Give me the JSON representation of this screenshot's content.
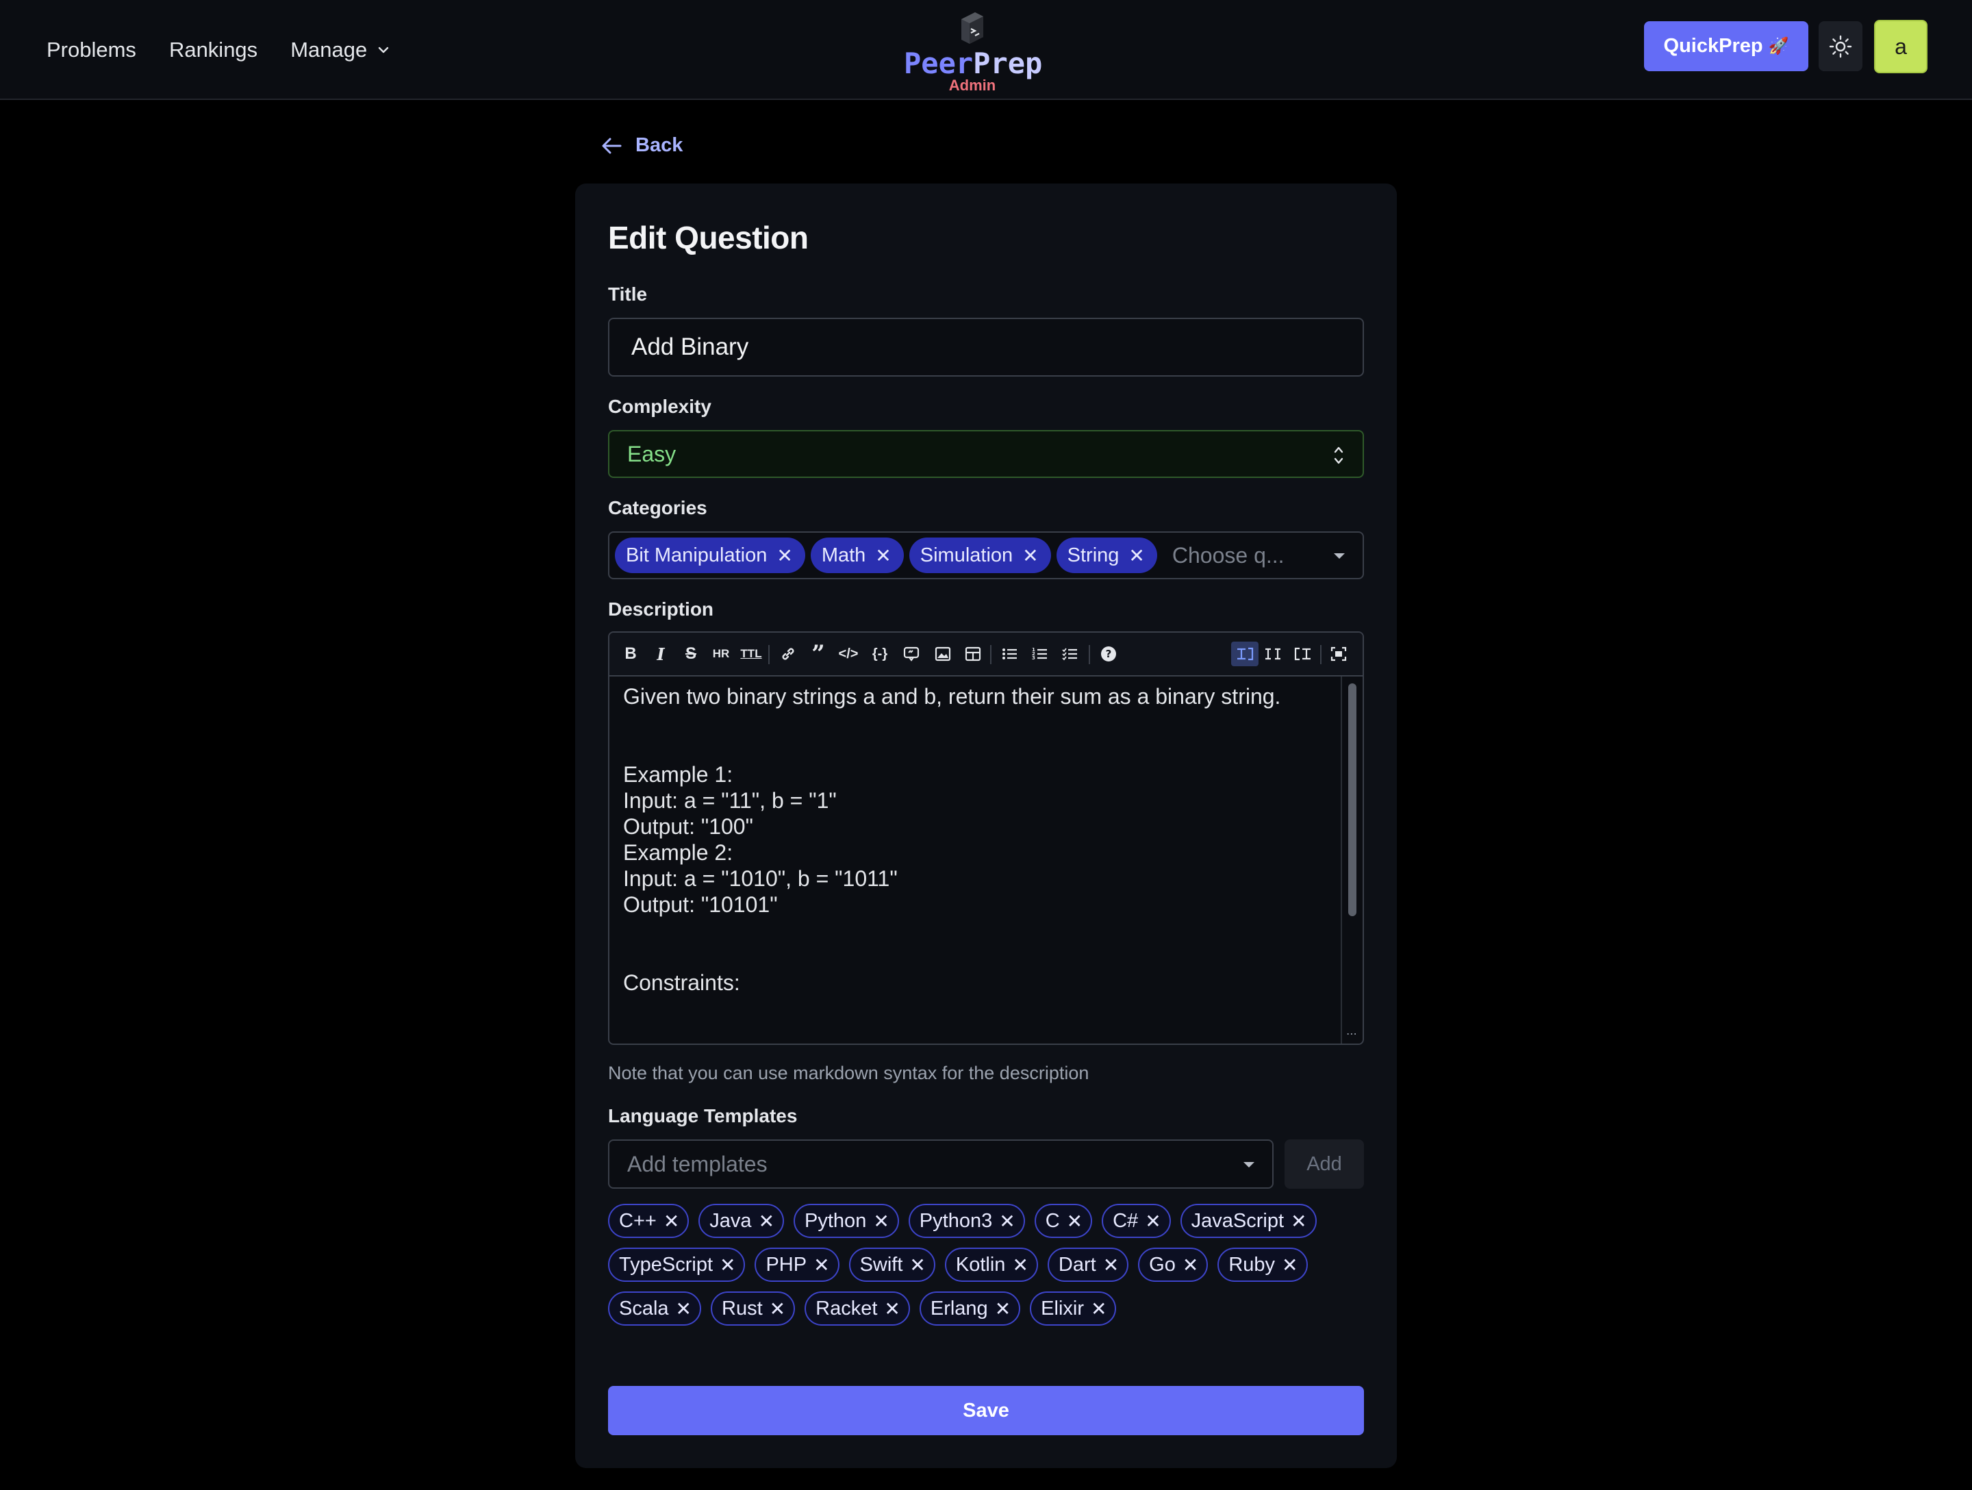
{
  "nav": {
    "problems": "Problems",
    "rankings": "Rankings",
    "manage": "Manage"
  },
  "brand": {
    "name_part1": "Peer",
    "name_part2": "Prep",
    "sub": "Admin"
  },
  "header": {
    "quickprep_label": "QuickPrep",
    "quickprep_emoji": "🚀",
    "avatar_letter": "a",
    "theme_icon": "sun-icon"
  },
  "back_label": "Back",
  "form": {
    "heading": "Edit Question",
    "title_label": "Title",
    "title_value": "Add Binary",
    "complexity_label": "Complexity",
    "complexity_value": "Easy",
    "categories_label": "Categories",
    "categories": [
      "Bit Manipulation",
      "Math",
      "Simulation",
      "String"
    ],
    "categories_placeholder": "Choose q...",
    "description_label": "Description",
    "description_text": "Given two binary strings a and b, return their sum as a binary string.\n\n\nExample 1:\nInput: a = \"11\", b = \"1\"\nOutput: \"100\"\nExample 2:\nInput: a = \"1010\", b = \"1011\"\nOutput: \"10101\"\n\n\nConstraints:",
    "description_note": "Note that you can use markdown syntax for the description",
    "templates_label": "Language Templates",
    "templates_placeholder": "Add templates",
    "add_label": "Add",
    "templates": [
      "C++",
      "Java",
      "Python",
      "Python3",
      "C",
      "C#",
      "JavaScript",
      "TypeScript",
      "PHP",
      "Swift",
      "Kotlin",
      "Dart",
      "Go",
      "Ruby",
      "Scala",
      "Rust",
      "Racket",
      "Erlang",
      "Elixir"
    ],
    "save_label": "Save"
  },
  "colors": {
    "accent": "#646cf6",
    "chip_solid": "#2a2fb0",
    "chip_outline": "#3d44c9",
    "complexity_text": "#86e08a",
    "avatar_bg": "#c3e35b"
  }
}
